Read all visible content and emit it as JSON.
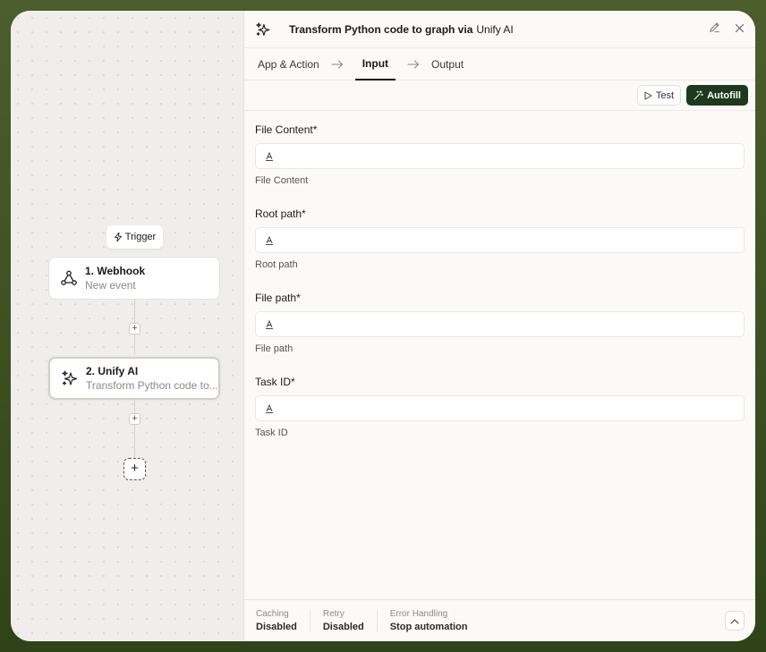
{
  "canvas": {
    "trigger_label": "Trigger",
    "nodes": [
      {
        "title": "1. Webhook",
        "subtitle": "New event",
        "icon": "webhook-icon"
      },
      {
        "title": "2. Unify AI",
        "subtitle": "Transform Python code to...",
        "icon": "sparkles-icon"
      }
    ],
    "add_step_symbol": "+"
  },
  "panel": {
    "title": "Transform Python code to graph via",
    "app_name": "Unify AI",
    "tabs": [
      {
        "label": "App & Action"
      },
      {
        "label": "Input"
      },
      {
        "label": "Output"
      }
    ],
    "test_label": "Test",
    "autofill_label": "Autofill",
    "fields": [
      {
        "label": "File Content*",
        "help": "File Content",
        "value": ""
      },
      {
        "label": "Root path*",
        "help": "Root path",
        "value": ""
      },
      {
        "label": "File path*",
        "help": "File path",
        "value": ""
      },
      {
        "label": "Task ID*",
        "help": "Task ID",
        "value": ""
      }
    ],
    "footer": {
      "caching_label": "Caching",
      "caching_value": "Disabled",
      "retry_label": "Retry",
      "retry_value": "Disabled",
      "error_label": "Error Handling",
      "error_value": "Stop automation"
    }
  },
  "colors": {
    "accent": "#1d3a1d",
    "frame_bg": "#3d5224"
  }
}
